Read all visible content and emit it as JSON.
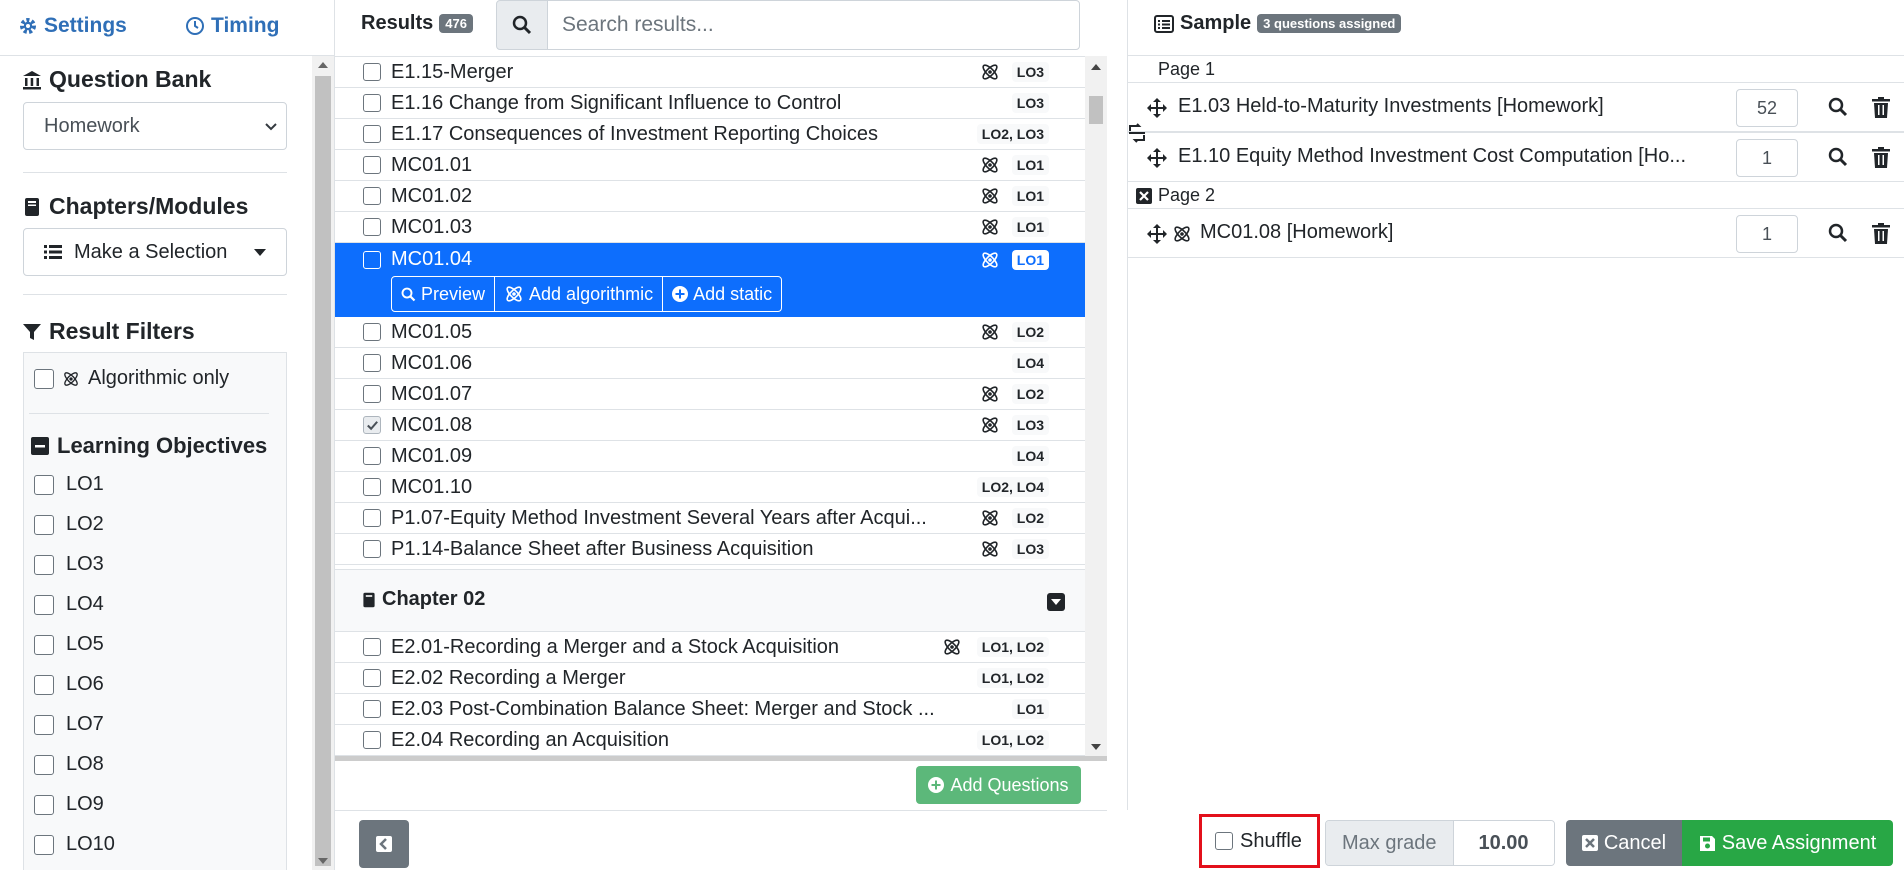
{
  "sidebar": {
    "tabs": {
      "settings": "Settings",
      "timing": "Timing"
    },
    "question_bank": {
      "title": "Question Bank",
      "selected": "Homework"
    },
    "chapters": {
      "title": "Chapters/Modules",
      "button": "Make a Selection"
    },
    "filters": {
      "title": "Result Filters",
      "algorithmic_only": "Algorithmic only"
    },
    "learning_objectives": {
      "title": "Learning Objectives",
      "items": [
        "LO1",
        "LO2",
        "LO3",
        "LO4",
        "LO5",
        "LO6",
        "LO7",
        "LO8",
        "LO9",
        "LO10"
      ]
    }
  },
  "results": {
    "title": "Results",
    "count": "476",
    "search_placeholder": "Search results...",
    "rows": [
      {
        "name": "E1.15-Merger",
        "algorithmic": true,
        "lo": "LO3",
        "checked": false
      },
      {
        "name": "E1.16 Change from Significant Influence to Control",
        "algorithmic": false,
        "lo": "LO3",
        "checked": false
      },
      {
        "name": "E1.17 Consequences of Investment Reporting Choices",
        "algorithmic": false,
        "lo": "LO2, LO3",
        "checked": false
      },
      {
        "name": "MC01.01",
        "algorithmic": true,
        "lo": "LO1",
        "checked": false
      },
      {
        "name": "MC01.02",
        "algorithmic": true,
        "lo": "LO1",
        "checked": false
      },
      {
        "name": "MC01.03",
        "algorithmic": true,
        "lo": "LO1",
        "checked": false
      },
      {
        "name": "MC01.04",
        "algorithmic": true,
        "lo": "LO1",
        "checked": false,
        "selected": true
      },
      {
        "name": "MC01.05",
        "algorithmic": true,
        "lo": "LO2",
        "checked": false
      },
      {
        "name": "MC01.06",
        "algorithmic": false,
        "lo": "LO4",
        "checked": false
      },
      {
        "name": "MC01.07",
        "algorithmic": true,
        "lo": "LO2",
        "checked": false
      },
      {
        "name": "MC01.08",
        "algorithmic": true,
        "lo": "LO3",
        "checked": true
      },
      {
        "name": "MC01.09",
        "algorithmic": false,
        "lo": "LO4",
        "checked": false
      },
      {
        "name": "MC01.10",
        "algorithmic": false,
        "lo": "LO2, LO4",
        "checked": false
      },
      {
        "name": "P1.07-Equity Method Investment Several Years after Acqui...",
        "algorithmic": true,
        "lo": "LO2",
        "checked": false
      },
      {
        "name": "P1.14-Balance Sheet after Business Acquisition",
        "algorithmic": true,
        "lo": "LO3",
        "checked": false
      }
    ],
    "selected_actions": {
      "preview": "Preview",
      "add_algorithmic": "Add algorithmic",
      "add_static": "Add static"
    },
    "chapter2": {
      "title": "Chapter 02",
      "rows": [
        {
          "name": "E2.01-Recording a Merger and a Stock Acquisition",
          "algorithmic": true,
          "lo": "LO1, LO2"
        },
        {
          "name": "E2.02 Recording a Merger",
          "algorithmic": false,
          "lo": "LO1, LO2"
        },
        {
          "name": "E2.03 Post-Combination Balance Sheet: Merger and Stock ...",
          "algorithmic": false,
          "lo": "LO1"
        },
        {
          "name": "E2.04 Recording an Acquisition",
          "algorithmic": false,
          "lo": "LO1, LO2"
        }
      ]
    },
    "add_questions": "Add Questions"
  },
  "sample": {
    "title": "Sample",
    "assigned_badge": "3 questions assigned",
    "pages": [
      {
        "label": "Page 1",
        "items": [
          {
            "name": "E1.03 Held-to-Maturity Investments [Homework]",
            "points": "52",
            "algorithmic": false
          },
          {
            "name": "E1.10 Equity Method Investment Cost Computation [Ho...",
            "points": "1",
            "algorithmic": false
          }
        ]
      },
      {
        "label": "Page 2",
        "items": [
          {
            "name": "MC01.08 [Homework]",
            "points": "1",
            "algorithmic": true
          }
        ]
      }
    ]
  },
  "footer": {
    "shuffle": "Shuffle",
    "max_grade_label": "Max grade",
    "max_grade_value": "10.00",
    "cancel": "Cancel",
    "save": "Save Assignment"
  },
  "colors": {
    "accent": "#0d6efd",
    "link": "#2f6fb7",
    "success": "#28a745",
    "highlight": "#e3101b",
    "muted": "#6c757d"
  }
}
